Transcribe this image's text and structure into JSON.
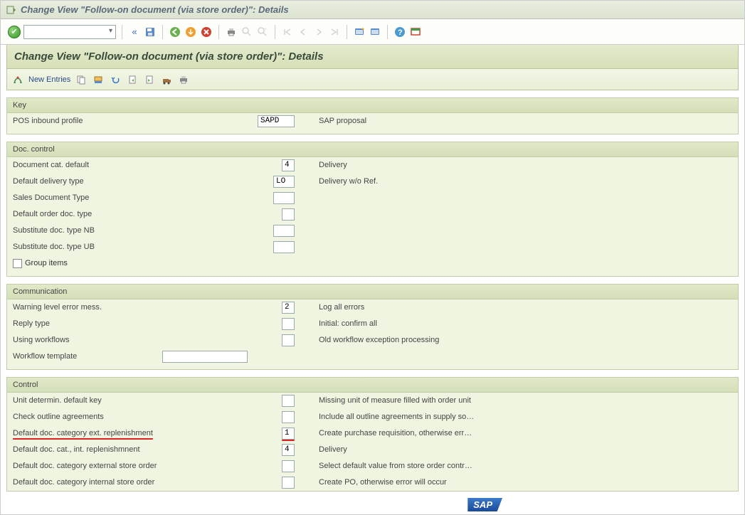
{
  "window_title": "Change View \"Follow-on document (via store order)\": Details",
  "subheader": "Change View \"Follow-on document (via store order)\": Details",
  "app_toolbar": {
    "new_entries": "New Entries"
  },
  "groups": {
    "key": {
      "title": "Key",
      "pos_inbound_profile_label": "POS inbound profile",
      "pos_inbound_profile_value": "SAPD",
      "pos_inbound_profile_desc": "SAP proposal"
    },
    "doc_control": {
      "title": "Doc. control",
      "rows": [
        {
          "label": "Document cat. default",
          "value": "4",
          "w": "w-short",
          "desc": "Delivery"
        },
        {
          "label": "Default delivery type",
          "value": "LO",
          "w": "w-med",
          "desc": "Delivery w/o Ref."
        },
        {
          "label": "Sales Document Type",
          "value": "",
          "w": "w-med",
          "desc": ""
        },
        {
          "label": "Default order doc. type",
          "value": "",
          "w": "w-short",
          "desc": ""
        },
        {
          "label": "Substitute doc. type NB",
          "value": "",
          "w": "w-med",
          "desc": ""
        },
        {
          "label": "Substitute doc. type UB",
          "value": "",
          "w": "w-med",
          "desc": ""
        }
      ],
      "group_items_label": "Group items"
    },
    "communication": {
      "title": "Communication",
      "rows": [
        {
          "label": "Warning level error mess.",
          "value": "2",
          "w": "w-short",
          "desc": "Log all errors"
        },
        {
          "label": "Reply type",
          "value": "",
          "w": "w-short",
          "desc": "Initial: confirm all"
        },
        {
          "label": "Using workflows",
          "value": "",
          "w": "w-short",
          "desc": "Old workflow exception processing"
        },
        {
          "label": "Workflow template",
          "value": "",
          "w": "w-wide",
          "desc": "",
          "wide": true
        }
      ]
    },
    "control": {
      "title": "Control",
      "rows": [
        {
          "label": "Unit determin. default key",
          "value": "",
          "w": "w-short",
          "desc": "Missing unit of measure filled with order unit"
        },
        {
          "label": "Check outline agreements",
          "value": "",
          "w": "w-short",
          "desc": "Include all outline agreements in supply so…"
        },
        {
          "label": "Default doc. category ext. replenishment",
          "value": "1",
          "w": "w-short",
          "desc": "Create purchase requisition, otherwise err…",
          "highlight": true
        },
        {
          "label": "Default doc. cat., int. replenishmnent",
          "value": "4",
          "w": "w-short",
          "desc": "Delivery"
        },
        {
          "label": "Default doc. category external store order",
          "value": "",
          "w": "w-short",
          "desc": "Select default value from store order contr…"
        },
        {
          "label": "Default doc. category internal store order",
          "value": "",
          "w": "w-short",
          "desc": "Create PO, otherwise error will occur"
        }
      ]
    }
  },
  "logo": "SAP"
}
